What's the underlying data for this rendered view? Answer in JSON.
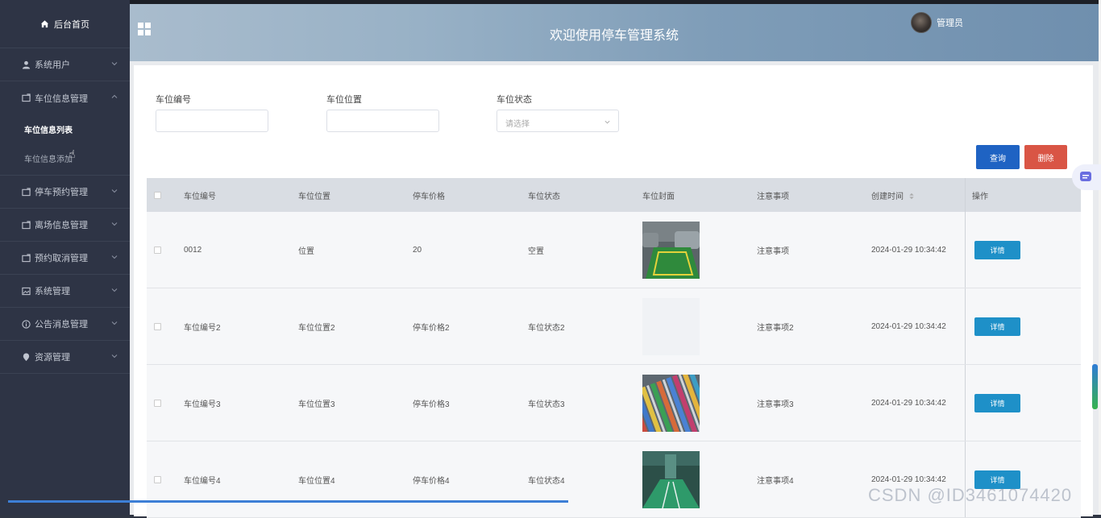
{
  "sidebar": {
    "home": "后台首页",
    "items": [
      {
        "label": "系统用户"
      },
      {
        "label": "车位信息管理"
      },
      {
        "label": "停车预约管理"
      },
      {
        "label": "离场信息管理"
      },
      {
        "label": "预约取消管理"
      },
      {
        "label": "系统管理"
      },
      {
        "label": "公告消息管理"
      },
      {
        "label": "资源管理"
      }
    ],
    "subitems": [
      "车位信息列表",
      "车位信息添加"
    ]
  },
  "header": {
    "title": "欢迎使用停车管理系统",
    "user": "管理员"
  },
  "filters": {
    "space_no_label": "车位编号",
    "location_label": "车位位置",
    "status_label": "车位状态",
    "status_placeholder": "请选择"
  },
  "buttons": {
    "query": "查询",
    "delete": "删除"
  },
  "table": {
    "headers": [
      "车位编号",
      "车位位置",
      "停车价格",
      "车位状态",
      "车位封面",
      "注意事项",
      "创建时间",
      "操作"
    ],
    "rows": [
      {
        "no": "0012",
        "loc": "位置",
        "price": "20",
        "status": "空置",
        "note": "注意事项",
        "time": "2024-01-29 10:34:42",
        "action": "详情"
      },
      {
        "no": "车位编号2",
        "loc": "车位位置2",
        "price": "停车价格2",
        "status": "车位状态2",
        "note": "注意事项2",
        "time": "2024-01-29 10:34:42",
        "action": "详情"
      },
      {
        "no": "车位编号3",
        "loc": "车位位置3",
        "price": "停车价格3",
        "status": "车位状态3",
        "note": "注意事项3",
        "time": "2024-01-29 10:34:42",
        "action": "详情"
      },
      {
        "no": "车位编号4",
        "loc": "车位位置4",
        "price": "停车价格4",
        "status": "车位状态4",
        "note": "注意事项4",
        "time": "2024-01-29 10:34:42",
        "action": "详情"
      }
    ]
  },
  "watermark": "CSDN @ID3461074420"
}
